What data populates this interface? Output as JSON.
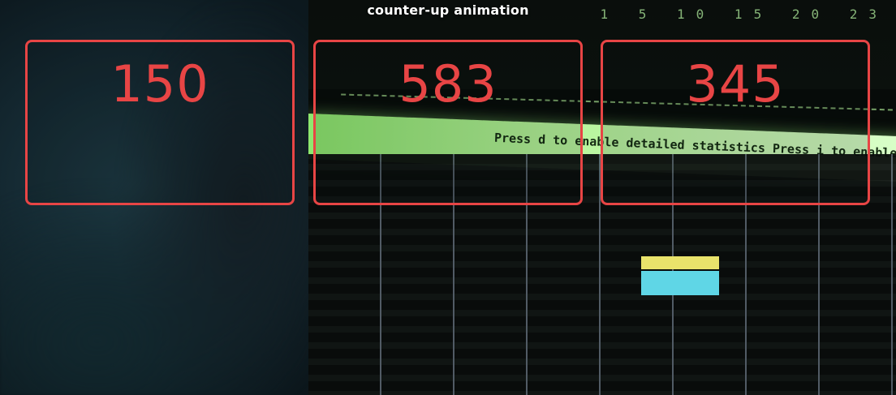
{
  "heading": "counter-up animation",
  "counters": [
    {
      "value": "150"
    },
    {
      "value": "583"
    },
    {
      "value": "345"
    }
  ],
  "background": {
    "terminal_band_text": "Press d to enable detailed statistics   Press i to enable additional information",
    "terminal_numbers": "1 5 10 15 20 23"
  },
  "colors": {
    "accent": "#e84545",
    "heading": "#ffffff",
    "terminal_green": "#8ee86e"
  }
}
